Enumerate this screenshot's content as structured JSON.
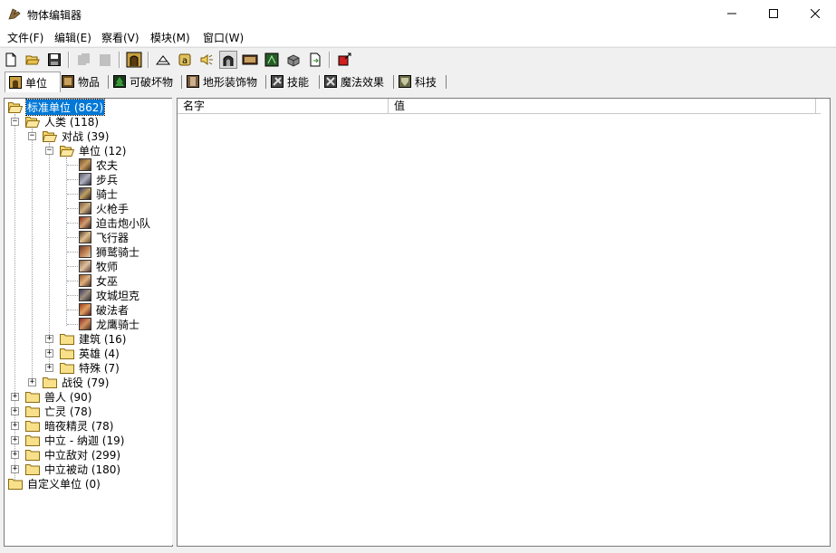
{
  "window": {
    "title": "物体编辑器"
  },
  "menu": [
    "文件(F)",
    "编辑(E)",
    "察看(V)",
    "模块(M)",
    "窗口(W)"
  ],
  "tabs": [
    {
      "label": "单位",
      "icon": "unit-icon",
      "color": "#8a6a2a"
    },
    {
      "label": "物品",
      "icon": "item-icon",
      "color": "#6a4a1a"
    },
    {
      "label": "可破坏物",
      "icon": "tree-icon",
      "color": "#2a6a2a"
    },
    {
      "label": "地形装饰物",
      "icon": "doodad-icon",
      "color": "#7a5a3a"
    },
    {
      "label": "技能",
      "icon": "ability-icon",
      "color": "#5a5a5a"
    },
    {
      "label": "魔法效果",
      "icon": "buff-icon",
      "color": "#5a5a5a"
    },
    {
      "label": "科技",
      "icon": "upgrade-icon",
      "color": "#6a6a4a"
    }
  ],
  "grid": {
    "columns": [
      "名字",
      "值"
    ]
  },
  "tree": {
    "root": "标准单位 (862)",
    "human": "人类 (118)",
    "melee": "对战 (39)",
    "units": "单位 (12)",
    "unit_list": [
      "农夫",
      "步兵",
      "骑士",
      "火枪手",
      "迫击炮小队",
      "飞行器",
      "狮鹫骑士",
      "牧师",
      "女巫",
      "攻城坦克",
      "破法者",
      "龙鹰骑士"
    ],
    "buildings": "建筑 (16)",
    "heroes": "英雄 (4)",
    "special": "特殊 (7)",
    "campaign": "战役 (79)",
    "races": [
      "兽人 (90)",
      "亡灵 (78)",
      "暗夜精灵 (78)",
      "中立 - 纳迦 (19)",
      "中立敌对 (299)",
      "中立被动 (180)"
    ],
    "custom": "自定义单位 (0)"
  },
  "colors": {
    "selection": "#0078d7",
    "folder": "#f5d36b"
  }
}
